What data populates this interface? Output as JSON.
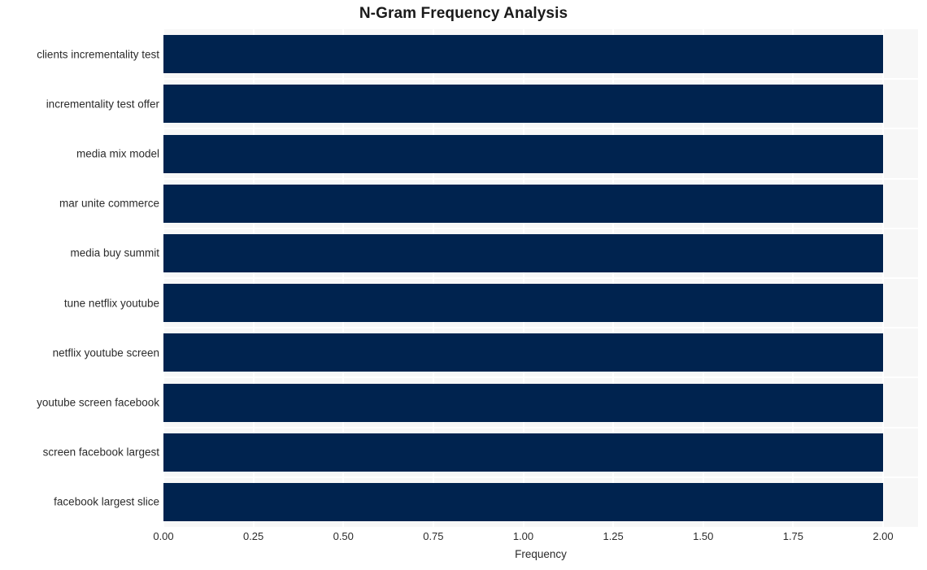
{
  "chart_data": {
    "type": "bar",
    "orientation": "horizontal",
    "title": "N-Gram Frequency Analysis",
    "xlabel": "Frequency",
    "ylabel": "",
    "categories": [
      "clients incrementality test",
      "incrementality test offer",
      "media mix model",
      "mar unite commerce",
      "media buy summit",
      "tune netflix youtube",
      "netflix youtube screen",
      "youtube screen facebook",
      "screen facebook largest",
      "facebook largest slice"
    ],
    "values": [
      2,
      2,
      2,
      2,
      2,
      2,
      2,
      2,
      2,
      2
    ],
    "xlim": [
      0,
      2
    ],
    "xticks": [
      0,
      0.25,
      0.5,
      0.75,
      1,
      1.25,
      1.5,
      1.75,
      2
    ],
    "xtick_labels": [
      "0.00",
      "0.25",
      "0.50",
      "0.75",
      "1.00",
      "1.25",
      "1.50",
      "1.75",
      "2.00"
    ],
    "grid": true,
    "legend": false,
    "bar_color": "#00234f",
    "plot_background": "#f7f7f7",
    "gridline_color": "#ffffff"
  }
}
